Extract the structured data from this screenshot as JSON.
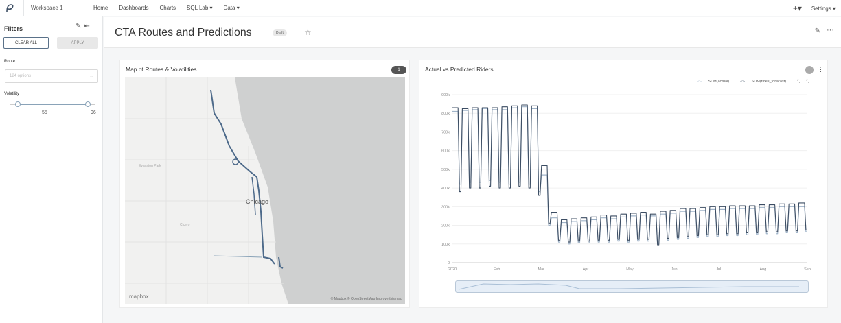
{
  "topnav": {
    "workspace": "Workspace 1",
    "items": [
      "Home",
      "Dashboards",
      "Charts",
      "SQL Lab ▾",
      "Data ▾"
    ],
    "plus": "+▾",
    "settings": "Settings ▾"
  },
  "filters": {
    "title": "Filters",
    "clear_all": "CLEAR ALL",
    "apply": "APPLY",
    "route_label": "Route",
    "route_placeholder": "124 options",
    "volatility_label": "Volatility",
    "volatility_min": "55",
    "volatility_max": "96",
    "volatility_range": [
      55,
      96
    ]
  },
  "header": {
    "title": "CTA Routes and Predictions",
    "status": "Draft"
  },
  "map_card": {
    "title": "Map of Routes & Volatilities",
    "badge": "1",
    "city_labels": [
      "Chicago",
      "Evanston Park",
      "Cicero"
    ],
    "logo": "mapbox",
    "attribution": "© Mapbox © OpenStreetMap Improve this map"
  },
  "chart_card": {
    "title": "Actual vs Predicted Riders",
    "legend": [
      "SUM(actual)",
      "SUM(rides_forecast)"
    ]
  },
  "chart_data": {
    "type": "line",
    "title": "Actual vs Predicted Riders",
    "xlabel": "",
    "ylabel": "",
    "x_ticks": [
      "2020",
      "Feb",
      "Mar",
      "Apr",
      "May",
      "Jun",
      "Jul",
      "Aug",
      "Sep"
    ],
    "y_ticks": [
      "0",
      "100k",
      "200k",
      "300k",
      "400k",
      "500k",
      "600k",
      "700k",
      "800k",
      "900k"
    ],
    "ylim": [
      0,
      900000
    ],
    "legend_position": "top-right",
    "series": [
      {
        "name": "SUM(actual)",
        "color": "#9fb3c8",
        "weekday_level": [
          810000,
          815000,
          820000,
          825000,
          820000,
          820000,
          830000,
          835000,
          825000,
          470000,
          240000,
          215000,
          220000,
          225000,
          230000,
          240000,
          235000,
          245000,
          250000,
          255000,
          250000,
          260000,
          265000,
          275000,
          275000,
          280000,
          285000,
          285000,
          290000,
          290000,
          290000,
          295000,
          295000,
          300000,
          300000,
          300000
        ],
        "weekend_level": [
          420000,
          430000,
          430000,
          440000,
          430000,
          420000,
          430000,
          420000,
          380000,
          200000,
          110000,
          100000,
          105000,
          105000,
          110000,
          110000,
          115000,
          110000,
          115000,
          115000,
          100000,
          120000,
          125000,
          130000,
          135000,
          140000,
          140000,
          145000,
          145000,
          150000,
          150000,
          155000,
          155000,
          160000,
          160000,
          165000
        ]
      },
      {
        "name": "SUM(rides_forecast)",
        "color": "#3c4d63",
        "weekday_level": [
          830000,
          825000,
          830000,
          830000,
          830000,
          835000,
          840000,
          845000,
          840000,
          520000,
          270000,
          230000,
          235000,
          240000,
          245000,
          255000,
          250000,
          260000,
          265000,
          270000,
          260000,
          275000,
          280000,
          290000,
          290000,
          295000,
          300000,
          300000,
          305000,
          305000,
          305000,
          310000,
          310000,
          315000,
          315000,
          320000
        ],
        "weekend_level": [
          380000,
          400000,
          400000,
          410000,
          400000,
          400000,
          410000,
          400000,
          360000,
          210000,
          120000,
          110000,
          115000,
          115000,
          120000,
          120000,
          125000,
          120000,
          125000,
          125000,
          95000,
          130000,
          135000,
          140000,
          145000,
          150000,
          150000,
          155000,
          155000,
          160000,
          160000,
          165000,
          165000,
          170000,
          170000,
          175000
        ]
      }
    ]
  },
  "colors": {
    "accent": "#5a7189",
    "map_water": "#cfd0d0",
    "map_land": "#f1f1f0",
    "route": "#4d6a8a"
  }
}
